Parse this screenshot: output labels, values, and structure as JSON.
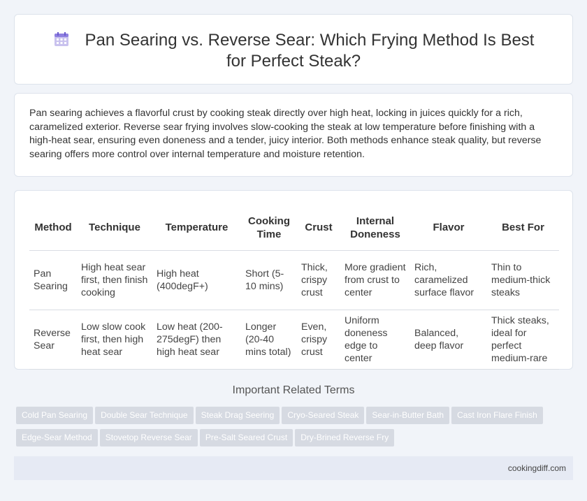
{
  "header": {
    "title": "Pan Searing vs. Reverse Sear: Which Frying Method Is Best for Perfect Steak?",
    "icon": "calendar-icon"
  },
  "intro": {
    "text": "Pan searing achieves a flavorful crust by cooking steak directly over high heat, locking in juices quickly for a rich, caramelized exterior. Reverse sear frying involves slow-cooking the steak at low temperature before finishing with a high-heat sear, ensuring even doneness and a tender, juicy interior. Both methods enhance steak quality, but reverse searing offers more control over internal temperature and moisture retention."
  },
  "table": {
    "headers": [
      "Method",
      "Technique",
      "Temperature",
      "Cooking Time",
      "Crust",
      "Internal Doneness",
      "Flavor",
      "Best For"
    ],
    "rows": [
      [
        "Pan Searing",
        "High heat sear first, then finish cooking",
        "High heat (400degF+)",
        "Short (5-10 mins)",
        "Thick, crispy crust",
        "More gradient from crust to center",
        "Rich, caramelized surface flavor",
        "Thin to medium-thick steaks"
      ],
      [
        "Reverse Sear",
        "Low slow cook first, then high heat sear",
        "Low heat (200-275degF) then high heat sear",
        "Longer (20-40 mins total)",
        "Even, crispy crust",
        "Uniform doneness edge to center",
        "Balanced, deep flavor",
        "Thick steaks, ideal for perfect medium-rare"
      ]
    ]
  },
  "related": {
    "title": "Important Related Terms",
    "tags_row1": [
      "Cold Pan Searing",
      "Double Sear Technique",
      "Steak Drag Seering",
      "Cryo-Seared Steak",
      "Sear-in-Butter Bath",
      "Cast Iron Flare Finish"
    ],
    "tags_row2": [
      "Edge-Sear Method",
      "Stovetop Reverse Sear",
      "Pre-Salt Seared Crust",
      "Dry-Brined Reverse Fry"
    ]
  },
  "footer": {
    "site": "cookingdiff.com"
  },
  "colors": {
    "background": "#f1f4f9",
    "tag": "#d6dae2",
    "footer": "#e6eaf4"
  }
}
